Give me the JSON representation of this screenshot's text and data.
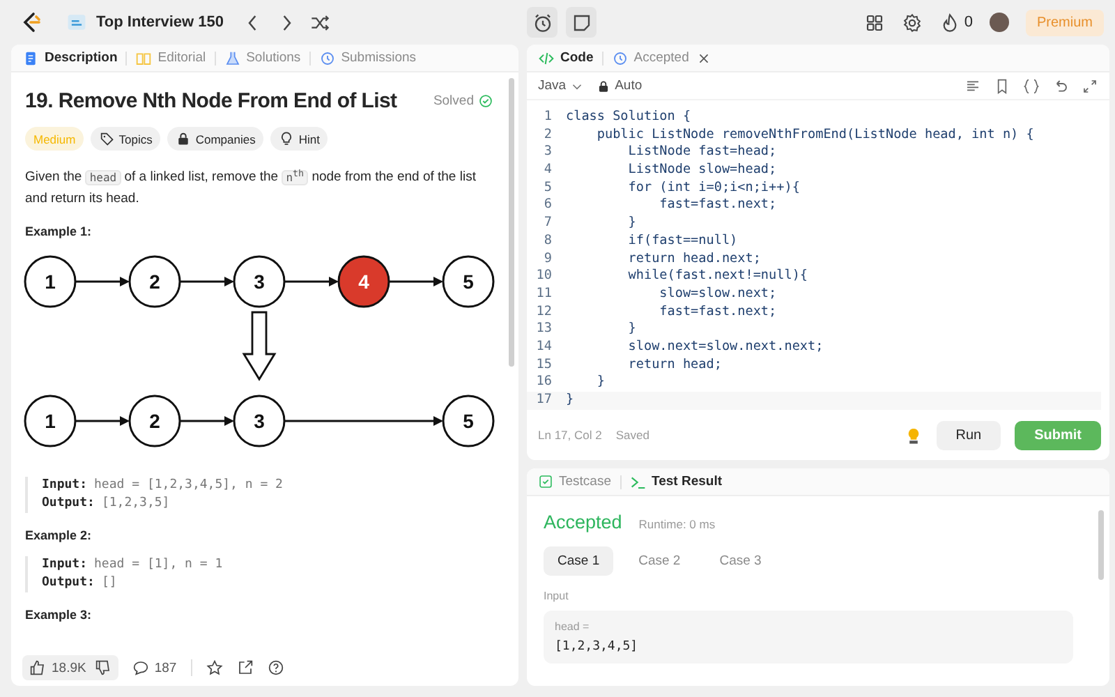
{
  "top_bar": {
    "list_title": "Top Interview 150",
    "premium": "Premium",
    "streak": "0"
  },
  "description_panel": {
    "tabs": [
      {
        "label": "Description",
        "kind": "description",
        "selected": true
      },
      {
        "label": "Editorial",
        "kind": "editorial",
        "selected": false
      },
      {
        "label": "Solutions",
        "kind": "solutions",
        "selected": false
      },
      {
        "label": "Submissions",
        "kind": "submissions",
        "selected": false
      }
    ],
    "title": "19. Remove Nth Node From End of List",
    "status": "Solved",
    "tags": [
      {
        "label": "Medium",
        "kind": "difficulty"
      },
      {
        "label": "Topics",
        "kind": "topics"
      },
      {
        "label": "Companies",
        "kind": "companies"
      },
      {
        "label": "Hint",
        "kind": "hint"
      }
    ],
    "description": [
      {
        "text": "Given the "
      },
      {
        "text": "head",
        "kind": "code"
      },
      {
        "text": " of a linked list, remove the "
      },
      {
        "text": "n$^{th}$",
        "kind": "code"
      },
      {
        "text": " node from the end of the list and return its head."
      }
    ],
    "examples": [
      {
        "heading": "Example 1:",
        "diagram": {
          "before": [
            {
              "label": "1",
              "removed": false
            },
            {
              "label": "2",
              "removed": false
            },
            {
              "label": "3",
              "removed": false
            },
            {
              "label": "4",
              "removed": true
            },
            {
              "label": "5",
              "removed": false
            }
          ],
          "after": [
            {
              "label": "1"
            },
            {
              "label": "2"
            },
            {
              "label": "3"
            },
            {
              "label": "5"
            }
          ]
        },
        "input": "head = [1,2,3,4,5], n = 2",
        "output": "[1,2,3,5]",
        "input_label": "Input:",
        "output_label": "Output:"
      },
      {
        "heading": "Example 2:",
        "input": "head = [1], n = 1",
        "output": "[]",
        "input_label": "Input:",
        "output_label": "Output:"
      },
      {
        "heading": "Example 3:"
      }
    ],
    "footer": {
      "likes": "18.9K",
      "comments": "187"
    }
  },
  "code_panel": {
    "tabs": [
      {
        "label": "Code",
        "kind": "code",
        "selected": true
      },
      {
        "label": "Accepted",
        "kind": "accepted",
        "selected": false
      }
    ],
    "language": "Java",
    "mode": "Auto",
    "lines": [
      {
        "number": "1",
        "code": "class Solution {"
      },
      {
        "number": "2",
        "code": "    public ListNode removeNthFromEnd(ListNode head, int n) {"
      },
      {
        "number": "3",
        "code": "        ListNode fast=head;"
      },
      {
        "number": "4",
        "code": "        ListNode slow=head;"
      },
      {
        "number": "5",
        "code": "        for (int i=0;i<n;i++){"
      },
      {
        "number": "6",
        "code": "            fast=fast.next;"
      },
      {
        "number": "7",
        "code": "        }"
      },
      {
        "number": "8",
        "code": "        if(fast==null)"
      },
      {
        "number": "9",
        "code": "        return head.next;"
      },
      {
        "number": "10",
        "code": "        while(fast.next!=null){"
      },
      {
        "number": "11",
        "code": "            slow=slow.next;"
      },
      {
        "number": "12",
        "code": "            fast=fast.next;"
      },
      {
        "number": "13",
        "code": "        }"
      },
      {
        "number": "14",
        "code": "        slow.next=slow.next.next;"
      },
      {
        "number": "15",
        "code": "        return head;"
      },
      {
        "number": "16",
        "code": "    }"
      },
      {
        "number": "17",
        "code": "}"
      }
    ],
    "cursor": "Ln 17, Col 2",
    "save_state": "Saved",
    "run": "Run",
    "submit": "Submit"
  },
  "test_panel": {
    "tabs": [
      {
        "label": "Testcase",
        "kind": "testcase",
        "selected": false
      },
      {
        "label": "Test Result",
        "kind": "result",
        "selected": true
      }
    ],
    "verdict": "Accepted",
    "runtime": "Runtime: 0 ms",
    "cases": [
      {
        "label": "Case 1",
        "selected": true
      },
      {
        "label": "Case 2",
        "selected": false
      },
      {
        "label": "Case 3",
        "selected": false
      }
    ],
    "input_heading": "Input",
    "param": "head =",
    "value": "[1,2,3,4,5]"
  }
}
